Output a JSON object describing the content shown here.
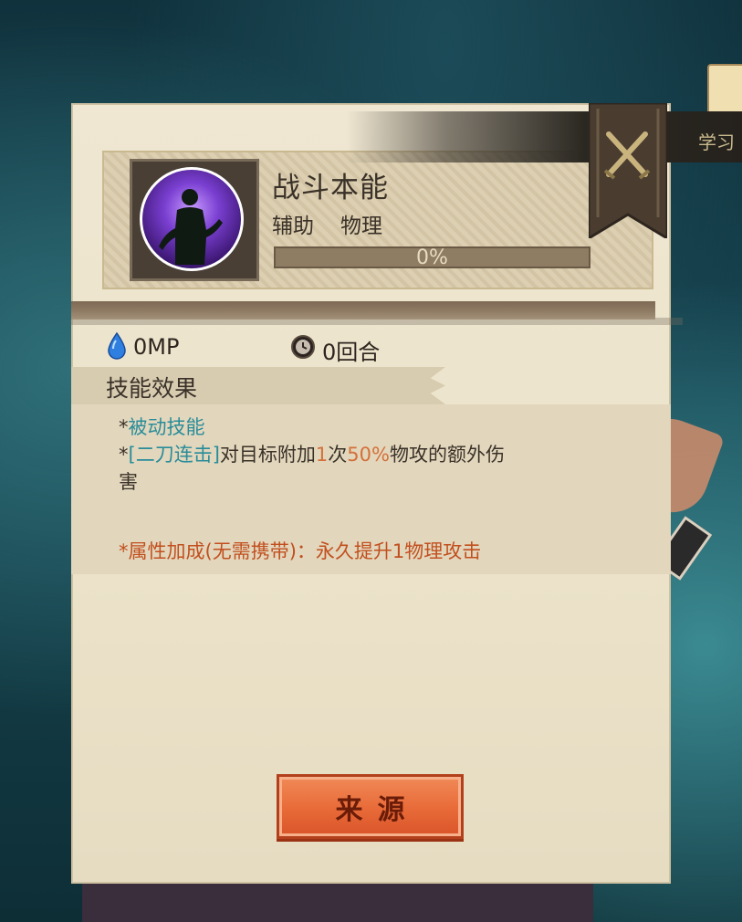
{
  "background_tab": {
    "label": "学习"
  },
  "skill": {
    "name": "战斗本能",
    "tag_a": "辅助",
    "tag_b": "物理",
    "icon": "fighter-silhouette-icon",
    "progress_fraction": 0,
    "progress_text": "0%"
  },
  "stats": {
    "mp_text": "0MP",
    "mp_icon": "mana-drop-icon",
    "turn_text": "0回合",
    "turn_icon": "clock-icon"
  },
  "effects": {
    "section_title": "技能效果",
    "line1_star": "*",
    "line1_text": "被动技能",
    "line2_star": "*",
    "line2_skill": "[二刀连击]",
    "line2_mid": "对目标附加",
    "line2_count": "1",
    "line2_unit": "次",
    "line2_pct": "50%",
    "line2_end": "物攻的额外伤",
    "line3_text": "害",
    "line4_text": "*属性加成(无需携带)：永久提升1物理攻击"
  },
  "buttons": {
    "source_label": "来源",
    "close_icon": "crossed-swords-close-icon"
  },
  "colors": {
    "panel": "#ebe2c9",
    "teal_text": "#2a8c99",
    "orange_text": "#d4703a",
    "red_text": "#c24f1e",
    "button": "#e86a38"
  }
}
